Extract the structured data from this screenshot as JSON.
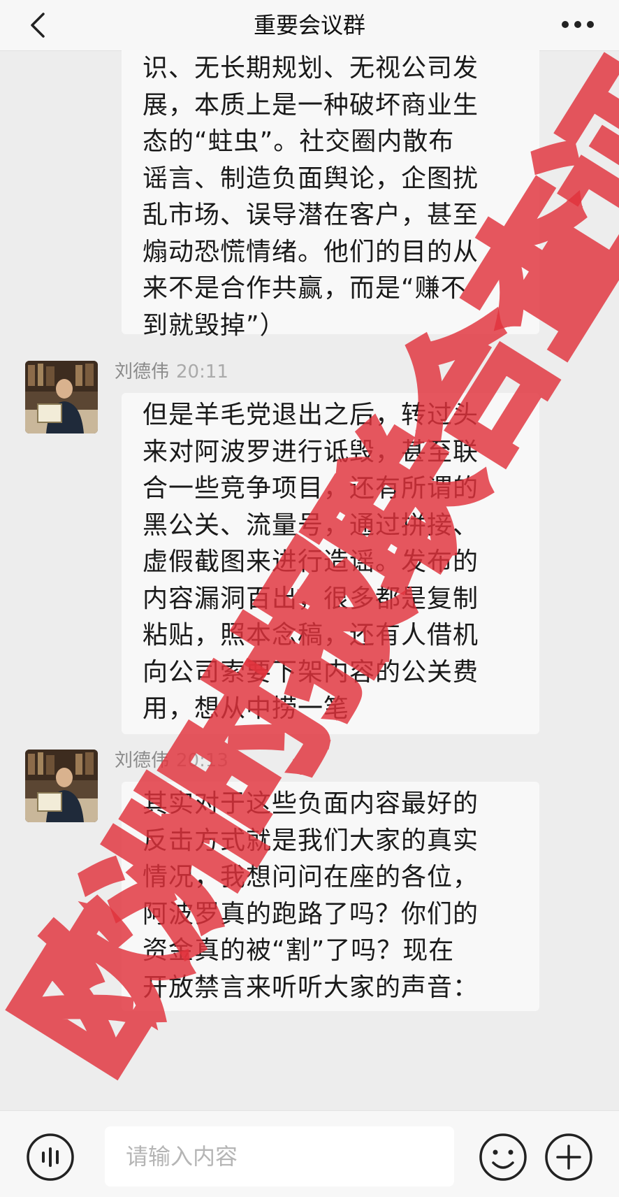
{
  "header": {
    "title": "重要会议群",
    "back_icon": "chevron-left-icon",
    "more_icon": "ellipsis-icon"
  },
  "messages": [
    {
      "sender": "",
      "time": "",
      "text": "识、无长期规划、无视公司发\n展，本质上是一种破坏商业生\n态的“蛀虫”。社交圈内散布\n谣言、制造负面舆论，企图扰\n乱市场、误导潜在客户，甚至\n煽动恐慌情绪。他们的目的从\n来不是合作共赢，而是“赚不\n到就毁掉”）"
    },
    {
      "sender": "刘德伟",
      "time": "20:11",
      "text": "但是羊毛党退出之后，转过头\n来对阿波罗进行诋毁，甚至联\n合一些竞争项目，还有所谓的\n黑公关、流量号，通过拼接、\n虚假截图来进行造谣。发布的\n内容漏洞百出，很多都是复制\n粘贴，照本念稿，还有人借机\n向公司索要下架内容的公关费\n用，想从中捞一笔"
    },
    {
      "sender": "刘德伟",
      "time": "20:13",
      "text": "其实对于这些负面内容最好的\n反击方式就是我们大家的真实\n情况，我想问问在座的各位，\n阿波罗真的跑路了吗？你们的\n资金真的被“割”了吗？现在\n开放禁言来听听大家的声音："
    }
  ],
  "watermark": {
    "text": "欧洲时报联合查证",
    "color": "#e0323c"
  },
  "input": {
    "placeholder": "请输入内容",
    "voice_icon": "voice-icon",
    "emoji_icon": "smiley-icon",
    "plus_icon": "plus-circle-icon"
  },
  "colors": {
    "background": "#ededed",
    "bubble": "#f8f8f8",
    "header": "#f7f7f7"
  }
}
